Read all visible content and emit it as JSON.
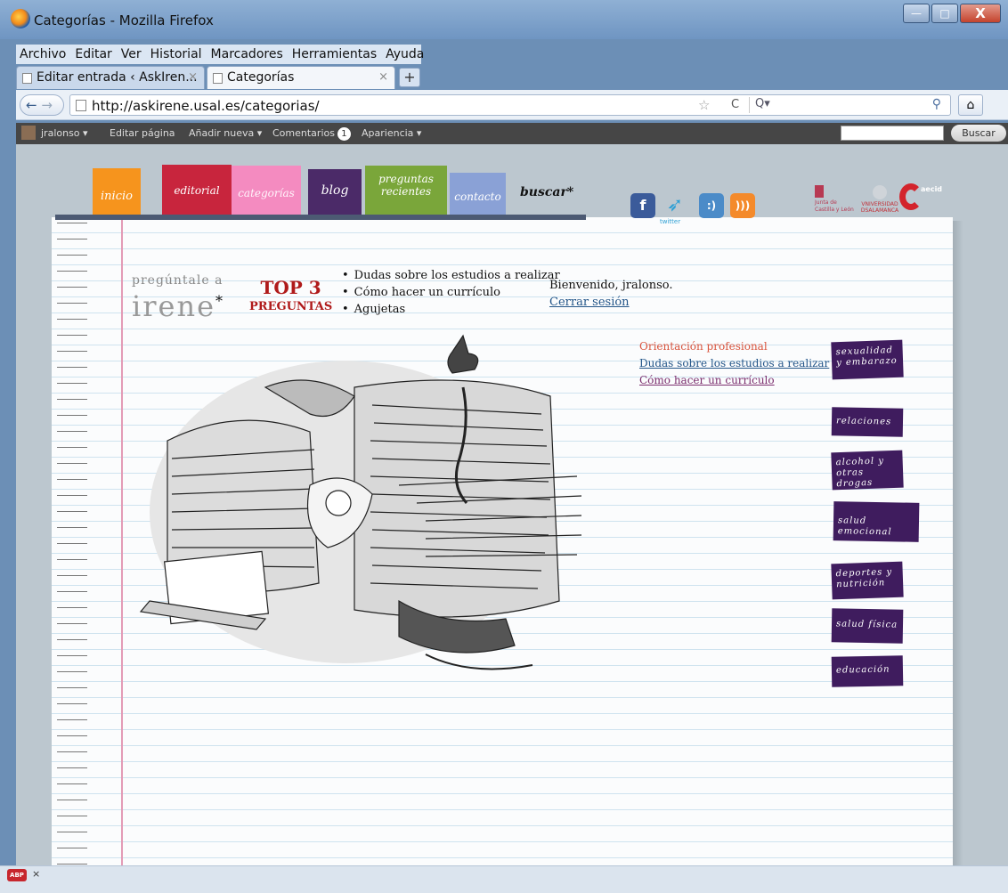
{
  "window": {
    "title": "Categorías - Mozilla Firefox",
    "minimize": "—",
    "maximize": "□",
    "close": "X"
  },
  "menu": [
    "Archivo",
    "Editar",
    "Ver",
    "Historial",
    "Marcadores",
    "Herramientas",
    "Ayuda"
  ],
  "tabs": [
    {
      "label": "Editar entrada ‹ AskIren...",
      "close": "×"
    },
    {
      "label": "Categorías",
      "close": "×"
    }
  ],
  "new_tab": "+",
  "nav": {
    "back": "←",
    "forward": "→",
    "url": "http://askirene.usal.es/categorias/",
    "star": "☆",
    "reload": "C",
    "search_engine": "Q▾",
    "search_icon": "⚲",
    "home": "⌂"
  },
  "adminbar": {
    "user": "jralonso ▾",
    "edit_page": "Editar página",
    "add_new": "Añadir nueva ▾",
    "comments": "Comentarios",
    "comments_count": "1",
    "appearance": "Apariencia ▾",
    "search_button": "Buscar"
  },
  "site_nav": [
    {
      "label": "inicio",
      "color": "#f6941d"
    },
    {
      "label": "editorial",
      "color": "#c8253d"
    },
    {
      "label": "categorías",
      "color": "#f48bc0"
    },
    {
      "label": "blog",
      "color": "#4b2a68"
    },
    {
      "label": "preguntas recientes",
      "color": "#7aa63a"
    },
    {
      "label": "contacto",
      "color": "#8aa1d6"
    }
  ],
  "buscar": "buscar*",
  "social": {
    "facebook": "f",
    "twitter_word": "twitter",
    "bubble": ":)"
  },
  "logos": {
    "jcyl": "Junta de Castilla y León",
    "usal": "VNIVERSIDAD DSALAMANCA",
    "aecid": "aecid"
  },
  "brand": {
    "top": "pregúntale a",
    "main": "irene",
    "star": "*"
  },
  "top3": {
    "title": "TOP 3",
    "subtitle": "PREGUNTAS"
  },
  "top_questions": [
    "Dudas sobre los estudios a realizar",
    "Cómo hacer un currículo",
    "Agujetas"
  ],
  "welcome": "Bienvenido, jralonso.",
  "logout": "Cerrar sesión",
  "breadcrumbs": [
    "Orientación profesional",
    "Dudas sobre los estudios a realizar",
    "Cómo hacer un currículo"
  ],
  "categories": [
    "sexualidad y embarazo",
    "relaciones",
    "alcohol y otras drogas",
    "salud emocional",
    "deportes y nutrición",
    "salud física",
    "educación"
  ],
  "statusbar": {
    "abp": "ABP",
    "close": "×"
  }
}
